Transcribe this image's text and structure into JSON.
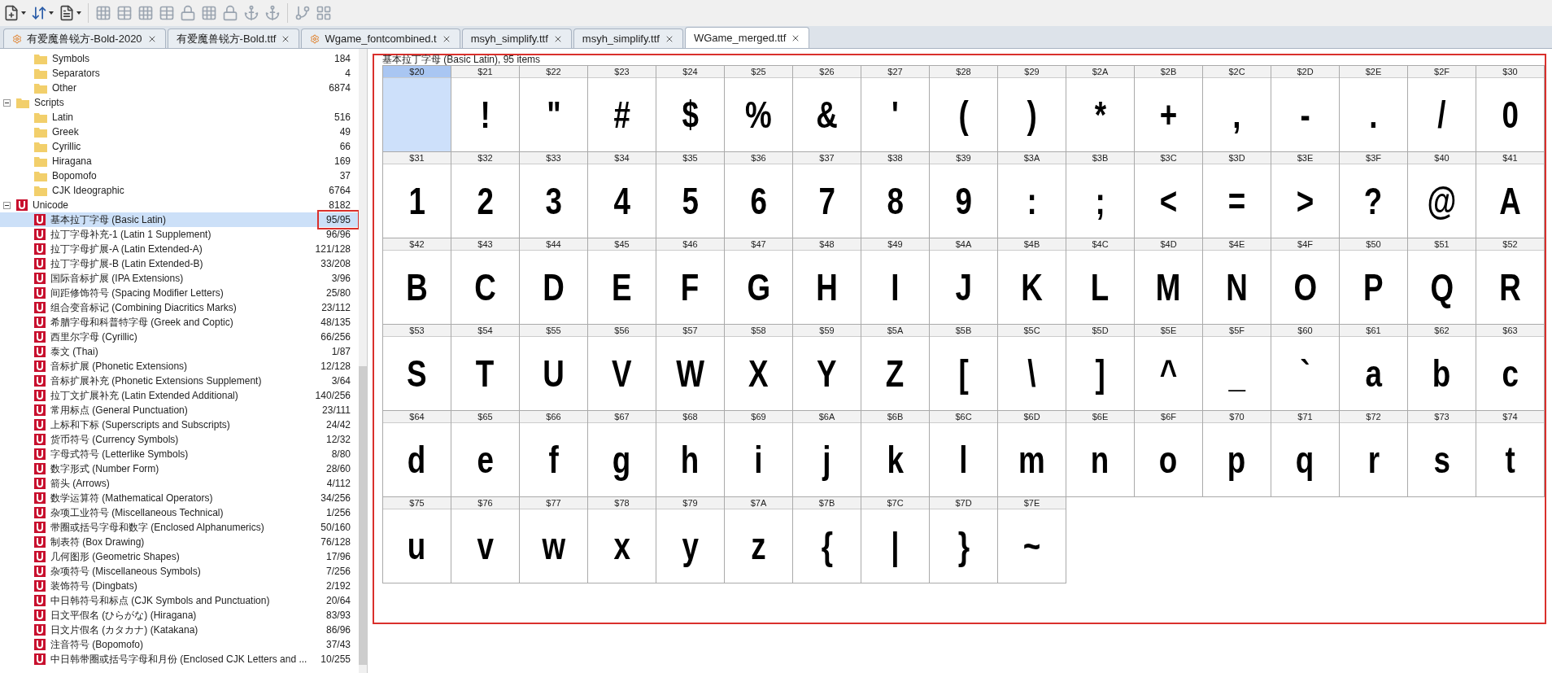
{
  "tabs": [
    {
      "label": "有爱魔兽锐方-Bold-2020",
      "modified": true,
      "selected": false
    },
    {
      "label": "有爱魔兽锐方-Bold.ttf",
      "modified": false,
      "selected": false
    },
    {
      "label": "Wgame_fontcombined.t",
      "modified": true,
      "selected": false
    },
    {
      "label": "msyh_simplify.ttf",
      "modified": false,
      "selected": false
    },
    {
      "label": "msyh_simplify.ttf",
      "modified": false,
      "selected": false
    },
    {
      "label": "WGame_merged.ttf",
      "modified": false,
      "selected": true
    }
  ],
  "tree": [
    {
      "kind": "folder",
      "children": [
        {
          "kind": "folder",
          "label": "Symbols",
          "count": "184",
          "selected": false
        },
        {
          "kind": "folder",
          "label": "Separators",
          "count": "4",
          "selected": false
        },
        {
          "kind": "folder",
          "label": "Other",
          "count": "6874",
          "selected": false
        }
      ]
    },
    {
      "kind": "folder",
      "label": "Scripts",
      "expanded": true,
      "selected": false,
      "children": [
        {
          "kind": "folder",
          "label": "Latin",
          "count": "516",
          "selected": false
        },
        {
          "kind": "folder",
          "label": "Greek",
          "count": "49",
          "selected": false
        },
        {
          "kind": "folder",
          "label": "Cyrillic",
          "count": "66",
          "selected": false
        },
        {
          "kind": "folder",
          "label": "Hiragana",
          "count": "169",
          "selected": false
        },
        {
          "kind": "folder",
          "label": "Bopomofo",
          "count": "37",
          "selected": false
        },
        {
          "kind": "folder",
          "label": "CJK Ideographic",
          "count": "6764",
          "selected": false
        }
      ]
    },
    {
      "kind": "unicode",
      "label": "Unicode",
      "count": "8182",
      "expanded": true,
      "selected": false,
      "children": [
        {
          "kind": "unicode",
          "label": "基本拉丁字母 (Basic Latin)",
          "count": "95/95",
          "selected": true,
          "marked": true
        },
        {
          "kind": "unicode",
          "label": "拉丁字母补充-1 (Latin 1 Supplement)",
          "count": "96/96",
          "selected": false,
          "marked": false
        },
        {
          "kind": "unicode",
          "label": "拉丁字母扩展-A (Latin Extended-A)",
          "count": "121/128",
          "selected": false,
          "marked": false
        },
        {
          "kind": "unicode",
          "label": "拉丁字母扩展-B (Latin Extended-B)",
          "count": "33/208",
          "selected": false,
          "marked": false
        },
        {
          "kind": "unicode",
          "label": "国际音标扩展 (IPA Extensions)",
          "count": "3/96",
          "selected": false,
          "marked": false
        },
        {
          "kind": "unicode",
          "label": "间距修饰符号 (Spacing Modifier Letters)",
          "count": "25/80",
          "selected": false,
          "marked": false
        },
        {
          "kind": "unicode",
          "label": "组合变音标记 (Combining Diacritics Marks)",
          "count": "23/112",
          "selected": false,
          "marked": false
        },
        {
          "kind": "unicode",
          "label": "希腊字母和科普特字母 (Greek and Coptic)",
          "count": "48/135",
          "selected": false,
          "marked": false
        },
        {
          "kind": "unicode",
          "label": "西里尔字母 (Cyrillic)",
          "count": "66/256",
          "selected": false,
          "marked": false
        },
        {
          "kind": "unicode",
          "label": "泰文 (Thai)",
          "count": "1/87",
          "selected": false,
          "marked": false
        },
        {
          "kind": "unicode",
          "label": "音标扩展 (Phonetic Extensions)",
          "count": "12/128",
          "selected": false,
          "marked": false
        },
        {
          "kind": "unicode",
          "label": "音标扩展补充 (Phonetic Extensions Supplement)",
          "count": "3/64",
          "selected": false,
          "marked": false
        },
        {
          "kind": "unicode",
          "label": "拉丁文扩展补充 (Latin Extended Additional)",
          "count": "140/256",
          "selected": false,
          "marked": false
        },
        {
          "kind": "unicode",
          "label": "常用标点 (General Punctuation)",
          "count": "23/111",
          "selected": false,
          "marked": false
        },
        {
          "kind": "unicode",
          "label": "上标和下标 (Superscripts and Subscripts)",
          "count": "24/42",
          "selected": false,
          "marked": false
        },
        {
          "kind": "unicode",
          "label": "货币符号 (Currency Symbols)",
          "count": "12/32",
          "selected": false,
          "marked": false
        },
        {
          "kind": "unicode",
          "label": "字母式符号 (Letterlike Symbols)",
          "count": "8/80",
          "selected": false,
          "marked": false
        },
        {
          "kind": "unicode",
          "label": "数字形式 (Number Form)",
          "count": "28/60",
          "selected": false,
          "marked": false
        },
        {
          "kind": "unicode",
          "label": "箭头 (Arrows)",
          "count": "4/112",
          "selected": false,
          "marked": false
        },
        {
          "kind": "unicode",
          "label": "数学运算符 (Mathematical Operators)",
          "count": "34/256",
          "selected": false,
          "marked": false
        },
        {
          "kind": "unicode",
          "label": "杂项工业符号 (Miscellaneous Technical)",
          "count": "1/256",
          "selected": false,
          "marked": false
        },
        {
          "kind": "unicode",
          "label": "带圈或括号字母和数字 (Enclosed Alphanumerics)",
          "count": "50/160",
          "selected": false,
          "marked": false
        },
        {
          "kind": "unicode",
          "label": "制表符 (Box Drawing)",
          "count": "76/128",
          "selected": false,
          "marked": false
        },
        {
          "kind": "unicode",
          "label": "几何图形 (Geometric Shapes)",
          "count": "17/96",
          "selected": false,
          "marked": false
        },
        {
          "kind": "unicode",
          "label": "杂项符号 (Miscellaneous Symbols)",
          "count": "7/256",
          "selected": false,
          "marked": false
        },
        {
          "kind": "unicode",
          "label": "装饰符号 (Dingbats)",
          "count": "2/192",
          "selected": false,
          "marked": false
        },
        {
          "kind": "unicode",
          "label": "中日韩符号和标点 (CJK Symbols and Punctuation)",
          "count": "20/64",
          "selected": false,
          "marked": false
        },
        {
          "kind": "unicode",
          "label": "日文平假名 (ひらがな) (Hiragana)",
          "count": "83/93",
          "selected": false,
          "marked": false
        },
        {
          "kind": "unicode",
          "label": "日文片假名 (カタカナ) (Katakana)",
          "count": "86/96",
          "selected": false,
          "marked": false
        },
        {
          "kind": "unicode",
          "label": "注音符号 (Bopomofo)",
          "count": "37/43",
          "selected": false,
          "marked": false
        },
        {
          "kind": "unicode",
          "label": "中日韩带圈或括号字母和月份 (Enclosed CJK Letters and ...",
          "count": "10/255",
          "selected": false,
          "marked": false
        }
      ]
    }
  ],
  "grid": {
    "title": "基本拉丁字母 (Basic Latin), 95 items",
    "marked": true,
    "cells": [
      {
        "code": "$20",
        "selected": true
      },
      {
        "code": "$21",
        "glyph": "!",
        "selected": false
      },
      {
        "code": "$22",
        "glyph": "\"",
        "selected": false
      },
      {
        "code": "$23",
        "glyph": "#",
        "selected": false
      },
      {
        "code": "$24",
        "glyph": "$",
        "selected": false
      },
      {
        "code": "$25",
        "glyph": "%",
        "selected": false
      },
      {
        "code": "$26",
        "glyph": "&",
        "selected": false
      },
      {
        "code": "$27",
        "glyph": "'",
        "selected": false
      },
      {
        "code": "$28",
        "glyph": "(",
        "selected": false
      },
      {
        "code": "$29",
        "glyph": ")",
        "selected": false
      },
      {
        "code": "$2A",
        "glyph": "*",
        "selected": false
      },
      {
        "code": "$2B",
        "glyph": "+",
        "selected": false
      },
      {
        "code": "$2C",
        "glyph": ",",
        "selected": false
      },
      {
        "code": "$2D",
        "glyph": "-",
        "selected": false
      },
      {
        "code": "$2E",
        "glyph": ".",
        "selected": false
      },
      {
        "code": "$2F",
        "glyph": "/",
        "selected": false
      },
      {
        "code": "$30",
        "glyph": "0",
        "selected": false
      },
      {
        "code": "$31",
        "glyph": "1",
        "selected": false
      },
      {
        "code": "$32",
        "glyph": "2",
        "selected": false
      },
      {
        "code": "$33",
        "glyph": "3",
        "selected": false
      },
      {
        "code": "$34",
        "glyph": "4",
        "selected": false
      },
      {
        "code": "$35",
        "glyph": "5",
        "selected": false
      },
      {
        "code": "$36",
        "glyph": "6",
        "selected": false
      },
      {
        "code": "$37",
        "glyph": "7",
        "selected": false
      },
      {
        "code": "$38",
        "glyph": "8",
        "selected": false
      },
      {
        "code": "$39",
        "glyph": "9",
        "selected": false
      },
      {
        "code": "$3A",
        "glyph": ":",
        "selected": false
      },
      {
        "code": "$3B",
        "glyph": ";",
        "selected": false
      },
      {
        "code": "$3C",
        "glyph": "<",
        "selected": false
      },
      {
        "code": "$3D",
        "glyph": "=",
        "selected": false
      },
      {
        "code": "$3E",
        "glyph": ">",
        "selected": false
      },
      {
        "code": "$3F",
        "glyph": "?",
        "selected": false
      },
      {
        "code": "$40",
        "glyph": "@",
        "selected": false
      },
      {
        "code": "$41",
        "glyph": "A",
        "selected": false
      },
      {
        "code": "$42",
        "glyph": "B",
        "selected": false
      },
      {
        "code": "$43",
        "glyph": "C",
        "selected": false
      },
      {
        "code": "$44",
        "glyph": "D",
        "selected": false
      },
      {
        "code": "$45",
        "glyph": "E",
        "selected": false
      },
      {
        "code": "$46",
        "glyph": "F",
        "selected": false
      },
      {
        "code": "$47",
        "glyph": "G",
        "selected": false
      },
      {
        "code": "$48",
        "glyph": "H",
        "selected": false
      },
      {
        "code": "$49",
        "glyph": "I",
        "selected": false
      },
      {
        "code": "$4A",
        "glyph": "J",
        "selected": false
      },
      {
        "code": "$4B",
        "glyph": "K",
        "selected": false
      },
      {
        "code": "$4C",
        "glyph": "L",
        "selected": false
      },
      {
        "code": "$4D",
        "glyph": "M",
        "selected": false
      },
      {
        "code": "$4E",
        "glyph": "N",
        "selected": false
      },
      {
        "code": "$4F",
        "glyph": "O",
        "selected": false
      },
      {
        "code": "$50",
        "glyph": "P",
        "selected": false
      },
      {
        "code": "$51",
        "glyph": "Q",
        "selected": false
      },
      {
        "code": "$52",
        "glyph": "R",
        "selected": false
      },
      {
        "code": "$53",
        "glyph": "S",
        "selected": false
      },
      {
        "code": "$54",
        "glyph": "T",
        "selected": false
      },
      {
        "code": "$55",
        "glyph": "U",
        "selected": false
      },
      {
        "code": "$56",
        "glyph": "V",
        "selected": false
      },
      {
        "code": "$57",
        "glyph": "W",
        "selected": false
      },
      {
        "code": "$58",
        "glyph": "X",
        "selected": false
      },
      {
        "code": "$59",
        "glyph": "Y",
        "selected": false
      },
      {
        "code": "$5A",
        "glyph": "Z",
        "selected": false
      },
      {
        "code": "$5B",
        "glyph": "[",
        "selected": false
      },
      {
        "code": "$5C",
        "glyph": "\\",
        "selected": false
      },
      {
        "code": "$5D",
        "glyph": "]",
        "selected": false
      },
      {
        "code": "$5E",
        "glyph": "^",
        "selected": false
      },
      {
        "code": "$5F",
        "glyph": "_",
        "selected": false
      },
      {
        "code": "$60",
        "glyph": "`",
        "selected": false
      },
      {
        "code": "$61",
        "glyph": "a",
        "selected": false
      },
      {
        "code": "$62",
        "glyph": "b",
        "selected": false
      },
      {
        "code": "$63",
        "glyph": "c",
        "selected": false
      },
      {
        "code": "$64",
        "glyph": "d",
        "selected": false
      },
      {
        "code": "$65",
        "glyph": "e",
        "selected": false
      },
      {
        "code": "$66",
        "glyph": "f",
        "selected": false
      },
      {
        "code": "$67",
        "glyph": "g",
        "selected": false
      },
      {
        "code": "$68",
        "glyph": "h",
        "selected": false
      },
      {
        "code": "$69",
        "glyph": "i",
        "selected": false
      },
      {
        "code": "$6A",
        "glyph": "j",
        "selected": false
      },
      {
        "code": "$6B",
        "glyph": "k",
        "selected": false
      },
      {
        "code": "$6C",
        "glyph": "l",
        "selected": false
      },
      {
        "code": "$6D",
        "glyph": "m",
        "selected": false
      },
      {
        "code": "$6E",
        "glyph": "n",
        "selected": false
      },
      {
        "code": "$6F",
        "glyph": "o",
        "selected": false
      },
      {
        "code": "$70",
        "glyph": "p",
        "selected": false
      },
      {
        "code": "$71",
        "glyph": "q",
        "selected": false
      },
      {
        "code": "$72",
        "glyph": "r",
        "selected": false
      },
      {
        "code": "$73",
        "glyph": "s",
        "selected": false
      },
      {
        "code": "$74",
        "glyph": "t",
        "selected": false
      },
      {
        "code": "$75",
        "glyph": "u",
        "selected": false
      },
      {
        "code": "$76",
        "glyph": "v",
        "selected": false
      },
      {
        "code": "$77",
        "glyph": "w",
        "selected": false
      },
      {
        "code": "$78",
        "glyph": "x",
        "selected": false
      },
      {
        "code": "$79",
        "glyph": "y",
        "selected": false
      },
      {
        "code": "$7A",
        "glyph": "z",
        "selected": false
      },
      {
        "code": "$7B",
        "glyph": "{",
        "selected": false
      },
      {
        "code": "$7C",
        "glyph": "|",
        "selected": false
      },
      {
        "code": "$7D",
        "glyph": "}",
        "selected": false
      },
      {
        "code": "$7E",
        "glyph": "~",
        "selected": false
      }
    ]
  }
}
